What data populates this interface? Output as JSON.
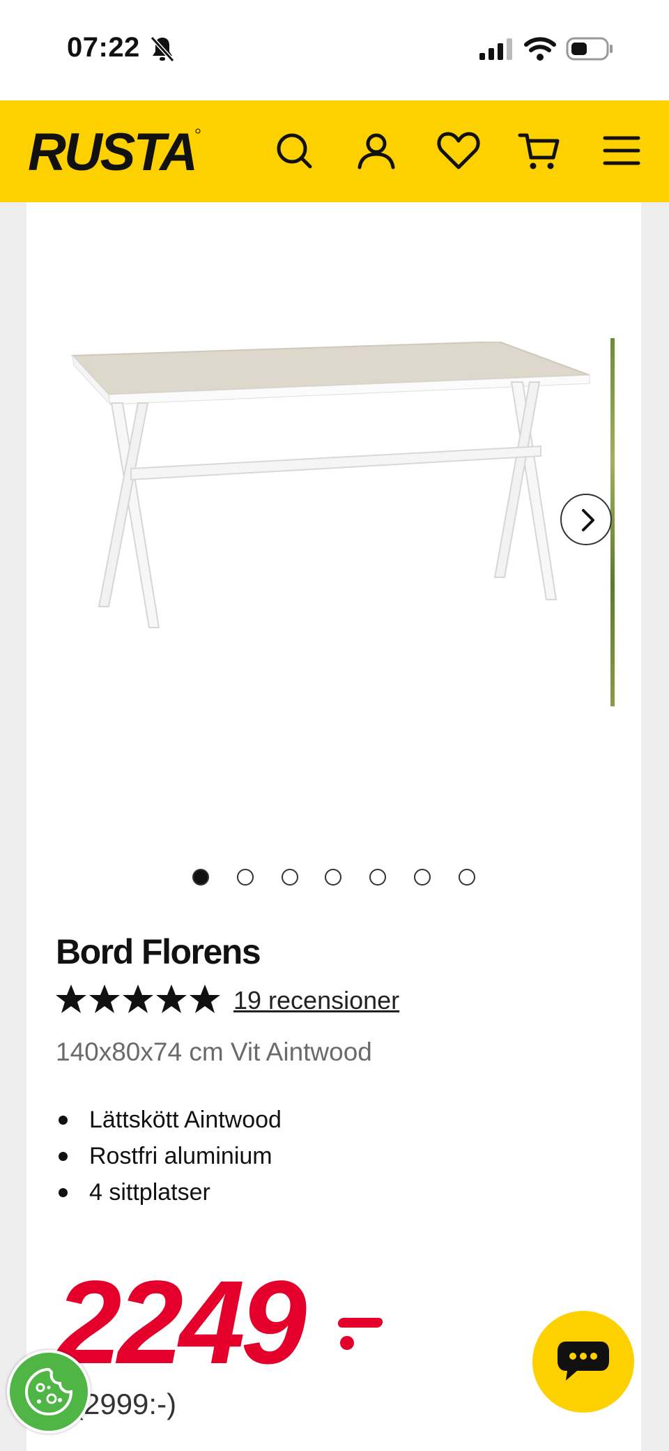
{
  "status_bar": {
    "time": "07:22"
  },
  "header": {
    "logo_text": "RUSTA",
    "brand_color": "#fdd000",
    "icons": [
      "search-icon",
      "account-icon",
      "heart-icon",
      "cart-icon",
      "menu-icon"
    ]
  },
  "gallery": {
    "slide_count": 7,
    "active_slide": 1
  },
  "product": {
    "title": "Bord Florens",
    "rating_stars": 5,
    "reviews_label": "19 recensioner",
    "subtitle": "140x80x74 cm Vit Aintwood",
    "features": [
      "Lättskött Aintwood",
      "Rostfri aluminium",
      "4 sittplatser"
    ],
    "price": "2249",
    "price_color": "#e4002b",
    "old_price": "(2999:-)"
  }
}
